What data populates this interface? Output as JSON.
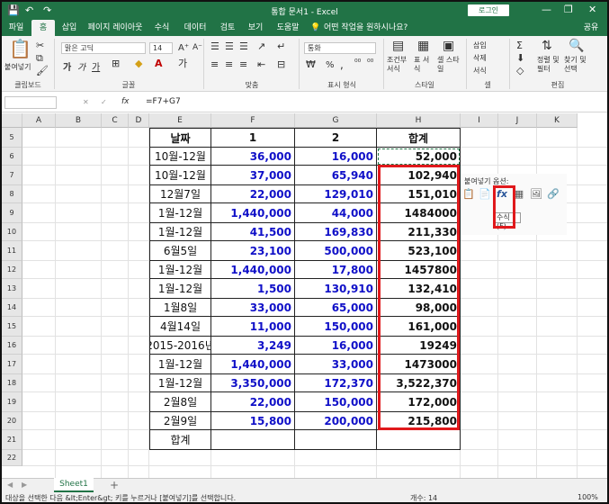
{
  "titlebar": {
    "title": "통합 문서1  -  Excel",
    "login": "로그인",
    "minimize": "—",
    "maximize": "❐",
    "close": "✕",
    "qa_save": "💾",
    "qa_undo": "↶",
    "qa_redo": "↷"
  },
  "tabs": [
    "파일",
    "홈",
    "삽입",
    "페이지 레이아웃",
    "수식",
    "데이터",
    "검토",
    "보기",
    "도움말",
    "어떤 작업을 원하시나요?"
  ],
  "share": "공유",
  "ribbon": {
    "paste_label": "붙여넣기",
    "clipboard_label": "클립보드",
    "font_name": "맑은 고딕",
    "font_size": "14",
    "font_label": "글꼴",
    "align_label": "맞춤",
    "number_format": "통화",
    "number_label": "표시 형식",
    "cond_format": "조건부 서식",
    "table_format": "표 서식",
    "cell_style": "셀 스타일",
    "style_label": "스타일",
    "insert": "삽입",
    "delete": "삭제",
    "format": "서식",
    "cells_label": "셀",
    "sort_filter": "정렬 및 필터",
    "find_select": "찾기 및 선택",
    "edit_label": "편집",
    "bold": "가",
    "italic": "가",
    "underline": "가",
    "percent": "%",
    "comma": ","
  },
  "formula_bar": {
    "fx": "fx",
    "cancel": "✕",
    "confirm": "✓",
    "formula": "=F7+G7"
  },
  "columns": [
    "A",
    "B",
    "C",
    "D",
    "E",
    "F",
    "G",
    "H",
    "I",
    "J",
    "K"
  ],
  "rows": [
    "5",
    "6",
    "7",
    "8",
    "9",
    "10",
    "11",
    "12",
    "13",
    "14",
    "15",
    "16",
    "17",
    "18",
    "19",
    "20",
    "21",
    "22"
  ],
  "table": {
    "headers": [
      "날짜",
      "1",
      "2",
      "합계"
    ],
    "rows": [
      [
        "10월-12월",
        "36,000",
        "16,000",
        "52,000"
      ],
      [
        "10월-12월",
        "37,000",
        "65,940",
        "102,940"
      ],
      [
        "12월7일",
        "22,000",
        "129,010",
        "151,010"
      ],
      [
        "1월-12월",
        "1,440,000",
        "44,000",
        "1484000"
      ],
      [
        "1월-12월",
        "41,500",
        "169,830",
        "211,330"
      ],
      [
        "6월5일",
        "23,100",
        "500,000",
        "523,100"
      ],
      [
        "1월-12월",
        "1,440,000",
        "17,800",
        "1457800"
      ],
      [
        "1월-12월",
        "1,500",
        "130,910",
        "132,410"
      ],
      [
        "1월8일",
        "33,000",
        "65,000",
        "98,000"
      ],
      [
        "4월14일",
        "11,000",
        "150,000",
        "161,000"
      ],
      [
        "2015-2016년",
        "3,249",
        "16,000",
        "19249"
      ],
      [
        "1월-12월",
        "1,440,000",
        "33,000",
        "1473000"
      ],
      [
        "1월-12월",
        "3,350,000",
        "172,370",
        "3,522,370"
      ],
      [
        "2월8일",
        "22,000",
        "150,000",
        "172,000"
      ],
      [
        "2월9일",
        "15,800",
        "200,000",
        "215,800"
      ]
    ],
    "footer": "합계"
  },
  "paste_options": {
    "title": "붙여넣기 옵션:",
    "tooltip": "수식 (F)",
    "icons": [
      "paste-icon",
      "paste-values-icon",
      "paste-formulas-icon",
      "paste-formatting-icon",
      "paste-picture-icon",
      "paste-link-icon"
    ]
  },
  "sheet_tab": "Sheet1",
  "add_sheet": "+",
  "status": {
    "message": "대상을 선택한 다음 &lt;Enter&gt; 키를 누르거나 [붙여넣기]를 선택합니다.",
    "count": "개수: 14",
    "zoom": "100%"
  },
  "colors": {
    "excel_green": "#217346",
    "number_blue": "#1010c8",
    "highlight_red": "#e0191c"
  }
}
